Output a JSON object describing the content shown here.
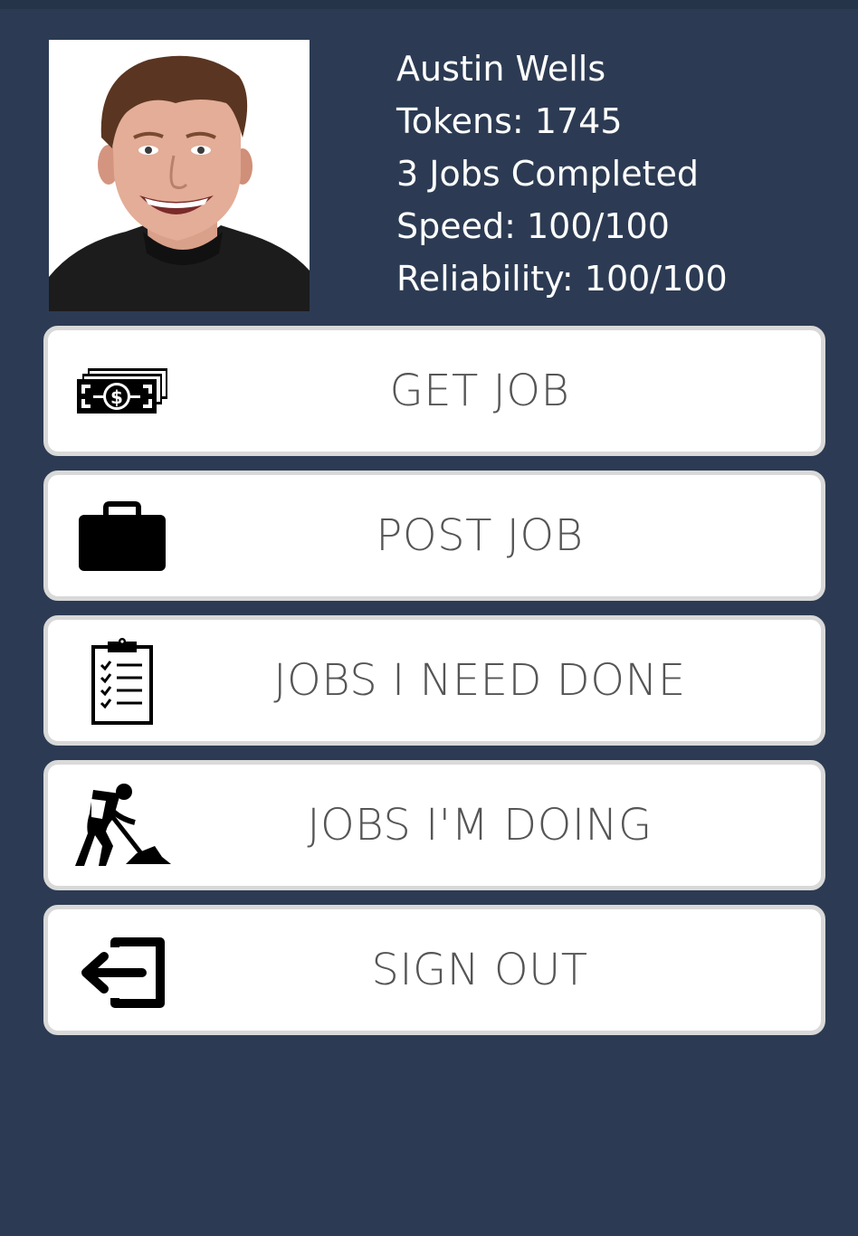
{
  "profile": {
    "name": "Austin Wells",
    "tokens": "Tokens: 1745",
    "jobs_completed": "3 Jobs Completed",
    "speed": "Speed: 100/100",
    "reliability": "Reliability: 100/100",
    "photo_alt": "Austin Wells"
  },
  "menu": {
    "get_job": {
      "label": "GET JOB",
      "icon": "money-stack-icon"
    },
    "post_job": {
      "label": "POST JOB",
      "icon": "briefcase-icon"
    },
    "jobs_i_need_done": {
      "label": "JOBS I NEED DONE",
      "icon": "clipboard-checklist-icon"
    },
    "jobs_im_doing": {
      "label": "JOBS I'M DOING",
      "icon": "worker-shovel-icon"
    },
    "sign_out": {
      "label": "SIGN OUT",
      "icon": "sign-out-icon"
    }
  },
  "colors": {
    "background": "#2c3b53",
    "button_background": "#ffffff",
    "button_border": "#d9d9d9",
    "button_text": "#555555",
    "profile_text": "#ffffff",
    "icon": "#000000"
  }
}
